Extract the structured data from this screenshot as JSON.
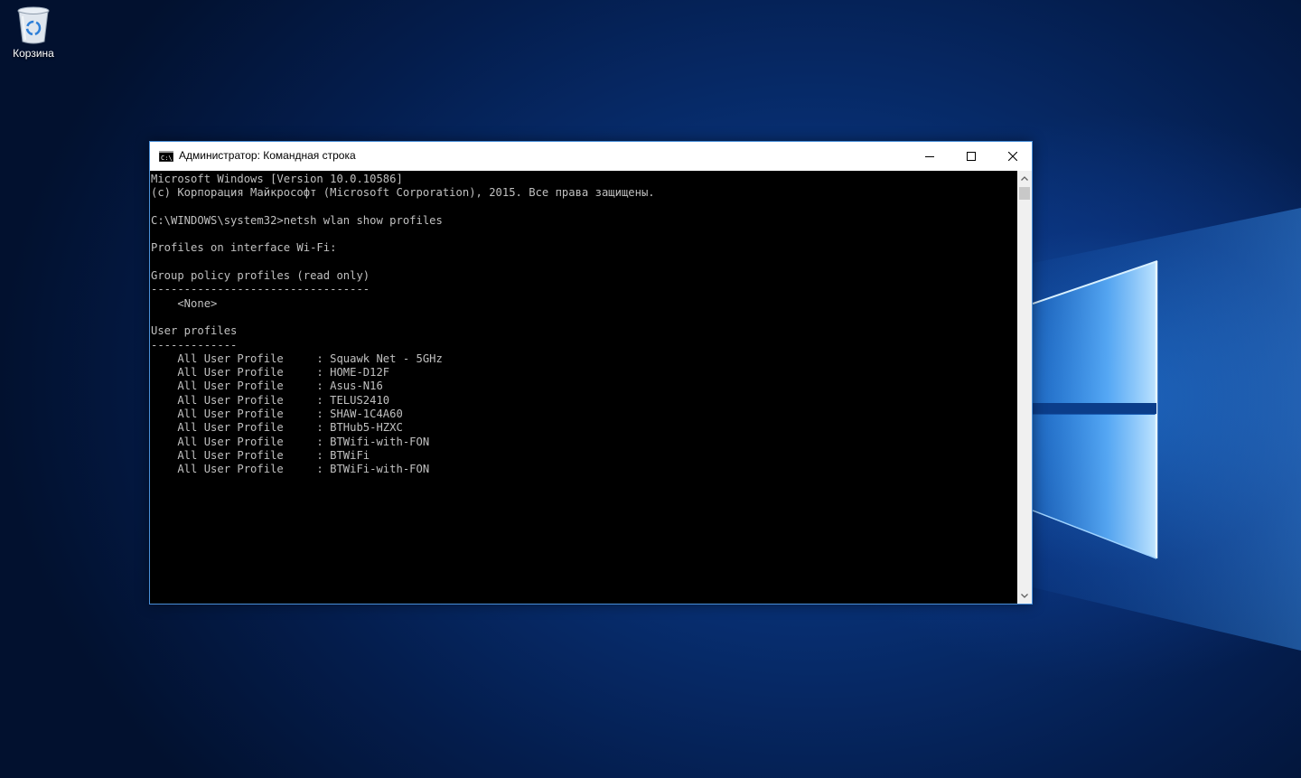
{
  "desktop": {
    "recycle_bin_label": "Корзина",
    "recycle_bin_icon": "recycle-bin-icon"
  },
  "window": {
    "title": "Администратор: Командная строка",
    "icon": "console-icon",
    "controls": {
      "minimize_icon": "minimize-icon",
      "maximize_icon": "maximize-icon",
      "close_icon": "close-icon"
    }
  },
  "console": {
    "lines": [
      "Microsoft Windows [Version 10.0.10586]",
      "(c) Корпорация Майкрософт (Microsoft Corporation), 2015. Все права защищены.",
      "",
      "C:\\WINDOWS\\system32>netsh wlan show profiles",
      "",
      "Profiles on interface Wi-Fi:",
      "",
      "Group policy profiles (read only)",
      "---------------------------------",
      "    <None>",
      "",
      "User profiles",
      "-------------",
      "    All User Profile     : Squawk Net - 5GHz",
      "    All User Profile     : HOME-D12F",
      "    All User Profile     : Asus-N16",
      "    All User Profile     : TELUS2410",
      "    All User Profile     : SHAW-1C4A60",
      "    All User Profile     : BTHub5-HZXC",
      "    All User Profile     : BTWifi-with-FON",
      "    All User Profile     : BTWiFi",
      "    All User Profile     : BTWiFi-with-FON"
    ]
  },
  "colors": {
    "console_bg": "#000000",
    "console_fg": "#c0c0c0",
    "window_border": "#4a90d9"
  }
}
